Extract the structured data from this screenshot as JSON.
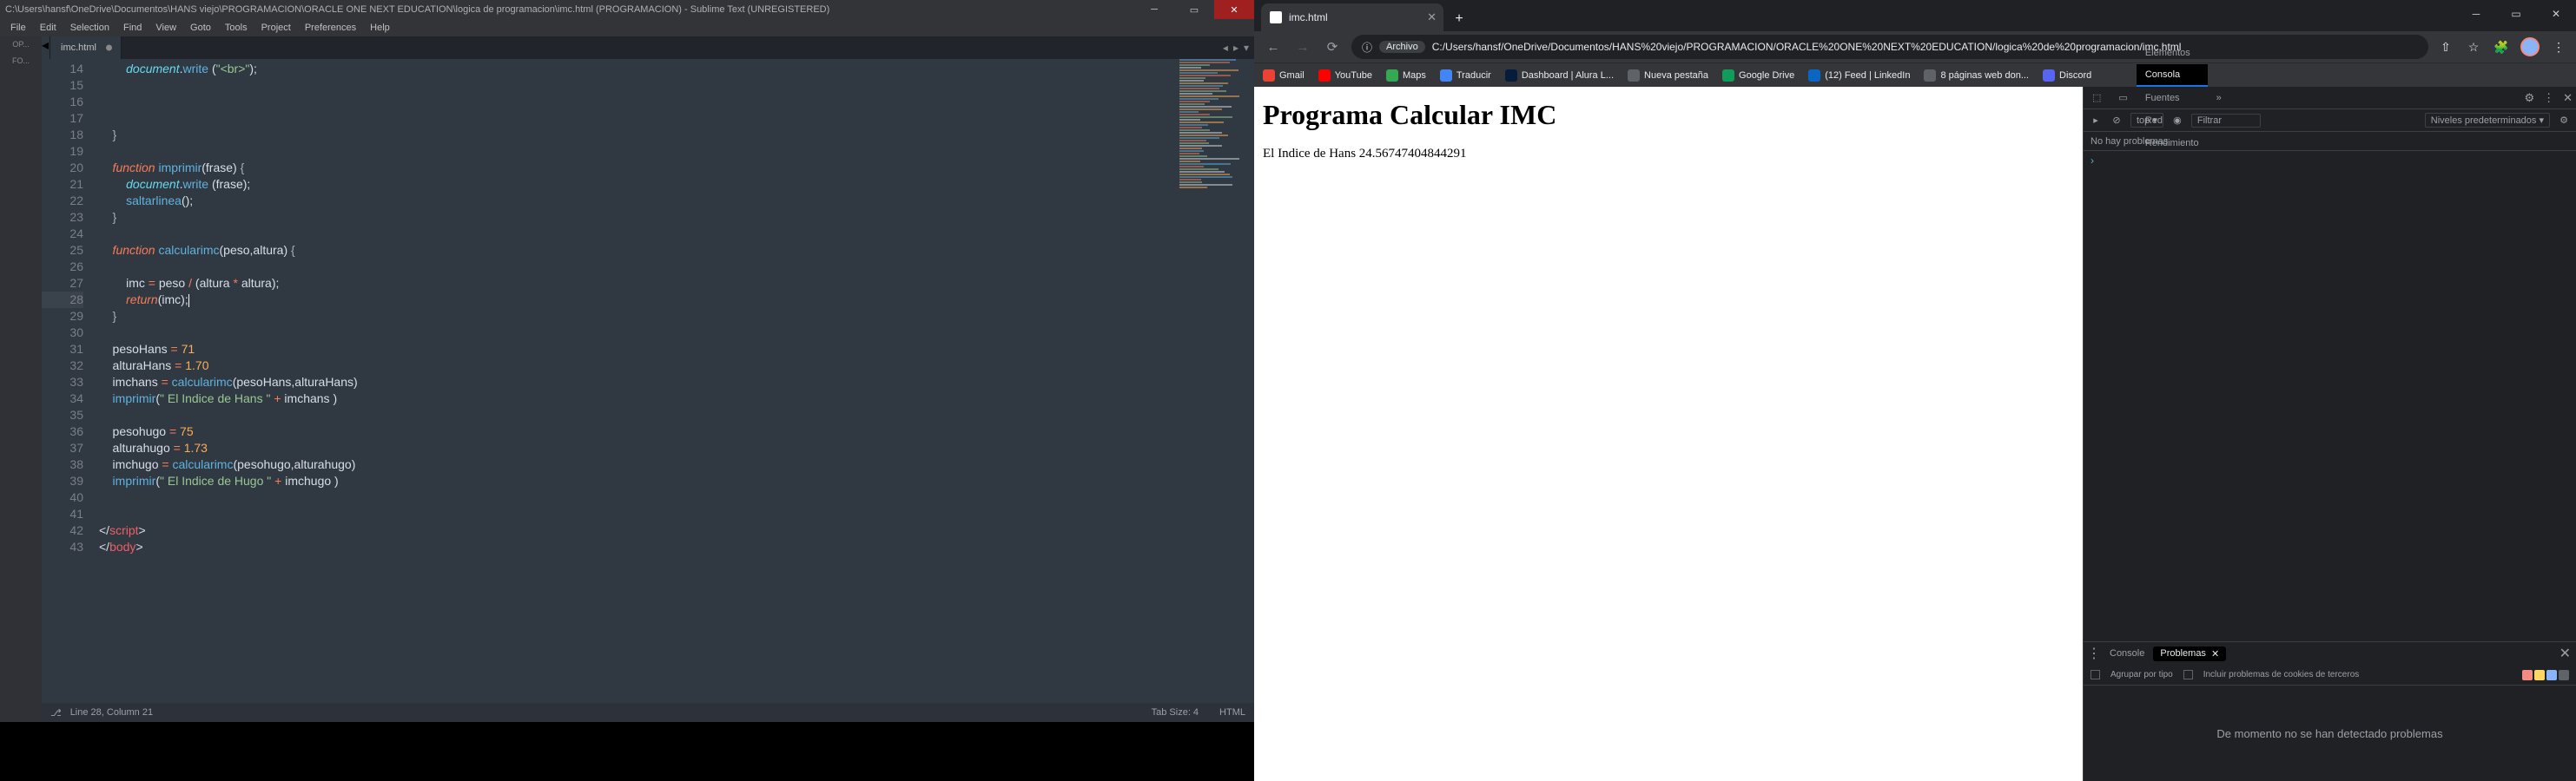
{
  "sublime": {
    "title": "C:\\Users\\hansf\\OneDrive\\Documentos\\HANS viejo\\PROGRAMACION\\ORACLE ONE NEXT EDUCATION\\logica de programacion\\imc.html (PROGRAMACION) - Sublime Text (UNREGISTERED)",
    "menu": [
      "File",
      "Edit",
      "Selection",
      "Find",
      "View",
      "Goto",
      "Tools",
      "Project",
      "Preferences",
      "Help"
    ],
    "left_strip": [
      "OP...",
      "FO..."
    ],
    "tab_name": "imc.html",
    "status_left": "Line 28, Column 21",
    "status_tab": "Tab Size: 4",
    "status_lang": "HTML",
    "code_lines": [
      {
        "n": 14,
        "seg": [
          {
            "c": "obj",
            "t": "        document"
          },
          {
            "c": "pun",
            "t": "."
          },
          {
            "c": "fn",
            "t": "write"
          },
          {
            "c": "pun",
            "t": " ("
          },
          {
            "c": "str",
            "t": "\"<br>\""
          },
          {
            "c": "pun",
            "t": ");"
          }
        ]
      },
      {
        "n": 15,
        "seg": []
      },
      {
        "n": 16,
        "seg": []
      },
      {
        "n": 17,
        "seg": []
      },
      {
        "n": 18,
        "seg": [
          {
            "c": "punb",
            "t": "    }"
          }
        ]
      },
      {
        "n": 19,
        "seg": []
      },
      {
        "n": 20,
        "seg": [
          {
            "c": "kw",
            "t": "    function"
          },
          {
            "c": "fn",
            "t": " imprimir"
          },
          {
            "c": "pun",
            "t": "("
          },
          {
            "c": "var",
            "t": "frase"
          },
          {
            "c": "pun",
            "t": ") "
          },
          {
            "c": "punb",
            "t": "{"
          }
        ]
      },
      {
        "n": 21,
        "seg": [
          {
            "c": "obj",
            "t": "        document"
          },
          {
            "c": "pun",
            "t": "."
          },
          {
            "c": "fn",
            "t": "write"
          },
          {
            "c": "pun",
            "t": " ("
          },
          {
            "c": "var",
            "t": "frase"
          },
          {
            "c": "pun",
            "t": ");"
          }
        ]
      },
      {
        "n": 22,
        "seg": [
          {
            "c": "fn",
            "t": "        saltarlinea"
          },
          {
            "c": "pun",
            "t": "();"
          }
        ]
      },
      {
        "n": 23,
        "seg": [
          {
            "c": "punb",
            "t": "    }"
          }
        ]
      },
      {
        "n": 24,
        "seg": []
      },
      {
        "n": 25,
        "seg": [
          {
            "c": "kw",
            "t": "    function"
          },
          {
            "c": "fn",
            "t": " calcularimc"
          },
          {
            "c": "pun",
            "t": "("
          },
          {
            "c": "var",
            "t": "peso"
          },
          {
            "c": "pun",
            "t": ","
          },
          {
            "c": "var",
            "t": "altura"
          },
          {
            "c": "pun",
            "t": ") "
          },
          {
            "c": "punb",
            "t": "{"
          }
        ]
      },
      {
        "n": 26,
        "seg": []
      },
      {
        "n": 27,
        "seg": [
          {
            "c": "var",
            "t": "        imc "
          },
          {
            "c": "op",
            "t": "="
          },
          {
            "c": "var",
            "t": " peso "
          },
          {
            "c": "op",
            "t": "/"
          },
          {
            "c": "pun",
            "t": " ("
          },
          {
            "c": "var",
            "t": "altura "
          },
          {
            "c": "op",
            "t": "*"
          },
          {
            "c": "var",
            "t": " altura"
          },
          {
            "c": "pun",
            "t": ");"
          }
        ]
      },
      {
        "n": 28,
        "active": true,
        "seg": [
          {
            "c": "kw",
            "t": "        return"
          },
          {
            "c": "pun",
            "t": "("
          },
          {
            "c": "var",
            "t": "imc"
          },
          {
            "c": "pun",
            "t": ");"
          },
          {
            "caret": true
          }
        ]
      },
      {
        "n": 29,
        "seg": [
          {
            "c": "punb",
            "t": "    }"
          }
        ]
      },
      {
        "n": 30,
        "seg": []
      },
      {
        "n": 31,
        "seg": [
          {
            "c": "var",
            "t": "    pesoHans "
          },
          {
            "c": "op",
            "t": "="
          },
          {
            "c": "num",
            "t": " 71"
          }
        ]
      },
      {
        "n": 32,
        "seg": [
          {
            "c": "var",
            "t": "    alturaHans "
          },
          {
            "c": "op",
            "t": "="
          },
          {
            "c": "num",
            "t": " 1.70"
          }
        ]
      },
      {
        "n": 33,
        "seg": [
          {
            "c": "var",
            "t": "    imchans "
          },
          {
            "c": "op",
            "t": "="
          },
          {
            "c": "fn",
            "t": " calcularimc"
          },
          {
            "c": "pun",
            "t": "("
          },
          {
            "c": "var",
            "t": "pesoHans"
          },
          {
            "c": "pun",
            "t": ","
          },
          {
            "c": "var",
            "t": "alturaHans"
          },
          {
            "c": "pun",
            "t": ")"
          }
        ]
      },
      {
        "n": 34,
        "seg": [
          {
            "c": "fn",
            "t": "    imprimir"
          },
          {
            "c": "pun",
            "t": "("
          },
          {
            "c": "str",
            "t": "\" El Indice de Hans \""
          },
          {
            "c": "op",
            "t": " +"
          },
          {
            "c": "var",
            "t": " imchans "
          },
          {
            "c": "pun",
            "t": ")"
          }
        ]
      },
      {
        "n": 35,
        "seg": []
      },
      {
        "n": 36,
        "seg": [
          {
            "c": "var",
            "t": "    pesohugo "
          },
          {
            "c": "op",
            "t": "="
          },
          {
            "c": "num",
            "t": " 75"
          }
        ]
      },
      {
        "n": 37,
        "seg": [
          {
            "c": "var",
            "t": "    alturahugo "
          },
          {
            "c": "op",
            "t": "="
          },
          {
            "c": "num",
            "t": " 1.73"
          }
        ]
      },
      {
        "n": 38,
        "seg": [
          {
            "c": "var",
            "t": "    imchugo "
          },
          {
            "c": "op",
            "t": "="
          },
          {
            "c": "fn",
            "t": " calcularimc"
          },
          {
            "c": "pun",
            "t": "("
          },
          {
            "c": "var",
            "t": "pesohugo"
          },
          {
            "c": "pun",
            "t": ","
          },
          {
            "c": "var",
            "t": "alturahugo"
          },
          {
            "c": "pun",
            "t": ")"
          }
        ]
      },
      {
        "n": 39,
        "seg": [
          {
            "c": "fn",
            "t": "    imprimir"
          },
          {
            "c": "pun",
            "t": "("
          },
          {
            "c": "str",
            "t": "\" El Indice de Hugo \""
          },
          {
            "c": "op",
            "t": " +"
          },
          {
            "c": "var",
            "t": " imchugo "
          },
          {
            "c": "pun",
            "t": ")"
          }
        ]
      },
      {
        "n": 40,
        "seg": []
      },
      {
        "n": 41,
        "seg": []
      },
      {
        "n": 42,
        "seg": [
          {
            "c": "pun",
            "t": "</"
          },
          {
            "c": "tag",
            "t": "script"
          },
          {
            "c": "pun",
            "t": ">"
          }
        ]
      },
      {
        "n": 43,
        "seg": [
          {
            "c": "pun",
            "t": "</"
          },
          {
            "c": "tag",
            "t": "body"
          },
          {
            "c": "pun",
            "t": ">"
          }
        ]
      }
    ]
  },
  "browser": {
    "tab_title": "imc.html",
    "url_chip": "Archivo",
    "url": "C:/Users/hansf/OneDrive/Documentos/HANS%20viejo/PROGRAMACION/ORACLE%20ONE%20NEXT%20EDUCATION/logica%20de%20programacion/imc.html",
    "bookmarks": [
      {
        "label": "Gmail",
        "color": "#ea4335"
      },
      {
        "label": "YouTube",
        "color": "#ff0000"
      },
      {
        "label": "Maps",
        "color": "#34a853"
      },
      {
        "label": "Traducir",
        "color": "#4285f4"
      },
      {
        "label": "Dashboard | Alura L...",
        "color": "#051d3b"
      },
      {
        "label": "Nueva pestaña",
        "color": "#5f6368"
      },
      {
        "label": "Google Drive",
        "color": "#0f9d58"
      },
      {
        "label": "(12) Feed | LinkedIn",
        "color": "#0a66c2"
      },
      {
        "label": "8 páginas web don...",
        "color": "#5f6368"
      },
      {
        "label": "Discord",
        "color": "#5865f2"
      }
    ]
  },
  "page": {
    "heading": "Programa Calcular IMC",
    "text": "El Indice de Hans 24.56747404844291"
  },
  "devtools": {
    "panels": [
      "Elementos",
      "Consola",
      "Fuentes",
      "Red",
      "Rendimiento"
    ],
    "active_panel": "Consola",
    "top_label": "top ▾",
    "filter_placeholder": "Filtrar",
    "levels": "Niveles predeterminados ▾",
    "issues": "No hay problemas",
    "drawer_tabs": [
      "Console",
      "Problemas"
    ],
    "drawer_active": "Problemas",
    "group_label": "Agrupar por tipo",
    "cookies_label": "Incluir problemas de cookies de terceros",
    "empty_msg": "De momento no se han detectado problemas",
    "badge_colors": [
      "#f28b82",
      "#fdd663",
      "#8ab4f8",
      "#5f6368"
    ]
  }
}
